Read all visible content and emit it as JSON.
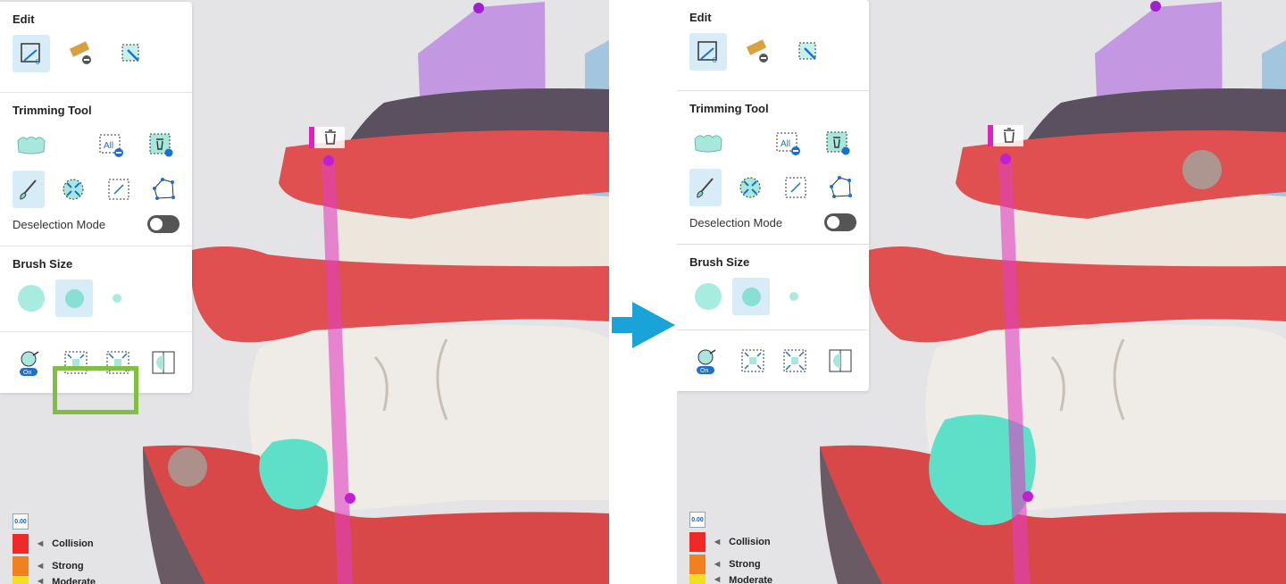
{
  "before": {
    "edit": {
      "title": "Edit",
      "tools": [
        "select-tool-icon",
        "brush-paint-icon",
        "magic-select-icon"
      ],
      "active_tool": 0
    },
    "trimming": {
      "title": "Trimming Tool",
      "tools_row1": [
        "gum-trim-icon",
        "deselect-all-icon",
        "delete-selection-icon"
      ],
      "all_label": "All",
      "tools_row2": [
        "paintbrush-icon",
        "shrink-selection-icon",
        "rect-select-icon",
        "polygon-select-icon"
      ],
      "active_brush": 0,
      "deselection_label": "Deselection Mode",
      "deselection_on": false
    },
    "brush_size": {
      "title": "Brush Size",
      "sizes": [
        "large",
        "medium",
        "small"
      ],
      "active": 1
    },
    "bottom_tools": [
      "visibility-toggle-icon",
      "shrink-selection-icon",
      "expand-selection-icon",
      "invert-selection-icon"
    ],
    "toggle_badge": "On",
    "legend": {
      "top_label": "0.00",
      "items": [
        {
          "label": "Collision",
          "color": "#f02828"
        },
        {
          "label": "Strong",
          "color": "#f08020"
        },
        {
          "label": "Moderate",
          "color": "#f0e020"
        }
      ]
    },
    "highlight_color": "#80c040"
  },
  "after": {
    "edit": {
      "title": "Edit",
      "tools": [
        "select-tool-icon",
        "brush-paint-icon",
        "magic-select-icon"
      ],
      "active_tool": 0
    },
    "trimming": {
      "title": "Trimming Tool",
      "tools_row1": [
        "gum-trim-icon",
        "deselect-all-icon",
        "delete-selection-icon"
      ],
      "all_label": "All",
      "tools_row2": [
        "paintbrush-icon",
        "shrink-selection-icon",
        "rect-select-icon",
        "polygon-select-icon"
      ],
      "active_brush": 0,
      "deselection_label": "Deselection Mode",
      "deselection_on": false
    },
    "brush_size": {
      "title": "Brush Size",
      "sizes": [
        "large",
        "medium",
        "small"
      ],
      "active": 1
    },
    "bottom_tools": [
      "visibility-toggle-icon",
      "shrink-selection-icon",
      "expand-selection-icon",
      "invert-selection-icon"
    ],
    "toggle_badge": "On",
    "legend": {
      "top_label": "0.00",
      "items": [
        {
          "label": "Collision",
          "color": "#f02828"
        },
        {
          "label": "Strong",
          "color": "#f08020"
        },
        {
          "label": "Moderate",
          "color": "#f0e020"
        }
      ]
    }
  },
  "arrow_color": "#1aa3d8",
  "selection_color": "#5ee0c8",
  "trash_icon": "trash-icon"
}
